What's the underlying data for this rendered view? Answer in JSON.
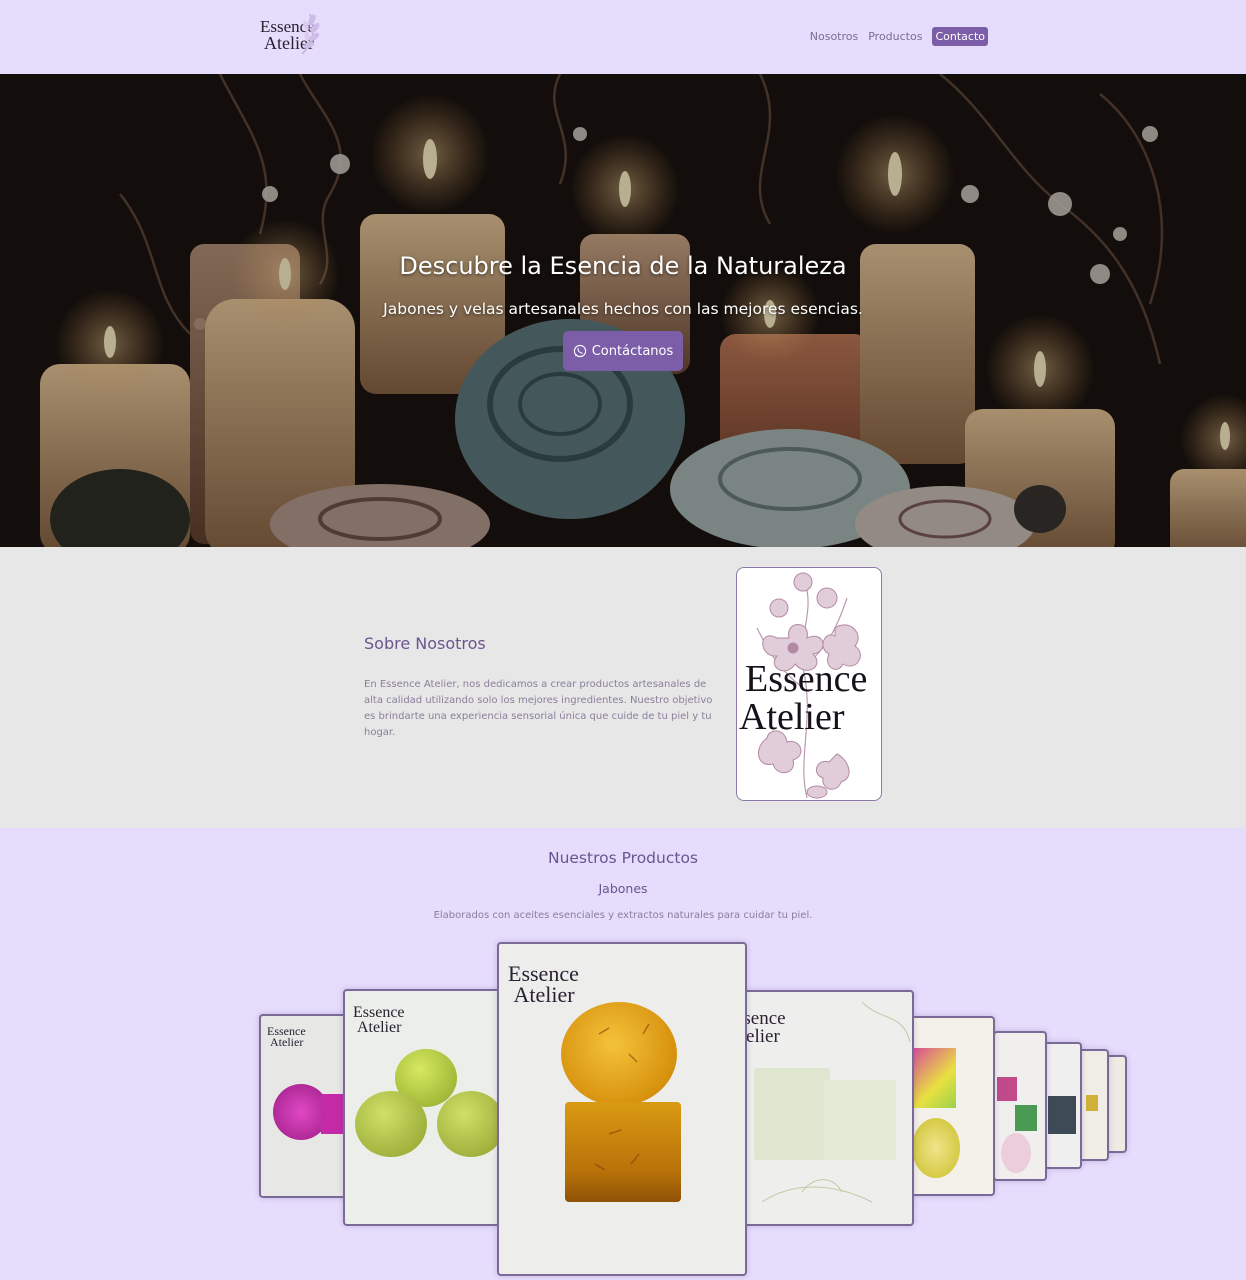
{
  "brand": {
    "name": "Essence Atelier",
    "line1": "Essence",
    "line2": "Atelier"
  },
  "nav": {
    "items": [
      {
        "label": "Nosotros",
        "active": false
      },
      {
        "label": "Productos",
        "active": false
      },
      {
        "label": "Contacto",
        "active": true
      }
    ]
  },
  "hero": {
    "title": "Descubre la Esencia de la Naturaleza",
    "subtitle": "Jabones y velas artesanales hechos con las mejores esencias.",
    "button_label": "Contáctanos",
    "button_icon": "whatsapp-icon"
  },
  "about": {
    "title": "Sobre Nosotros",
    "text": "En Essence Atelier, nos dedicamos a crear productos artesanales de alta calidad utilizando solo los mejores ingredientes. Nuestro objetivo es brindarte una experiencia sensorial única que cuide de tu piel y tu hogar."
  },
  "products": {
    "title": "Nuestros Productos",
    "category": "Jabones",
    "description": "Elaborados con aceites esenciales y extractos naturales para cuidar tu piel."
  },
  "colors": {
    "accent": "#7b5ea7",
    "page_bg": "#e6dcfc",
    "about_bg": "#e7e7e7",
    "title_text": "#6a5590"
  }
}
